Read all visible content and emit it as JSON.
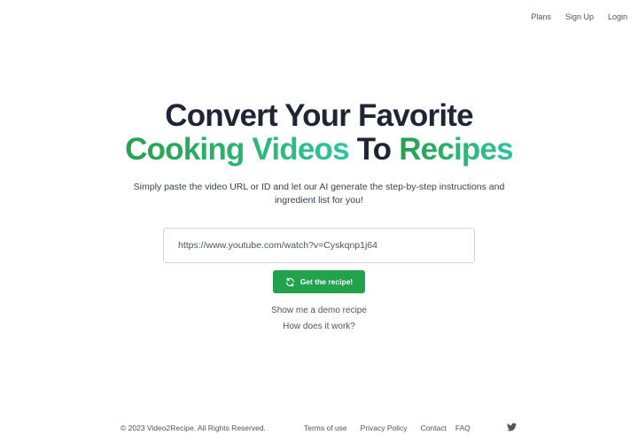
{
  "nav": {
    "plans": "Plans",
    "signup": "Sign Up",
    "login": "Login"
  },
  "hero": {
    "headline_line1": "Convert Your Favorite",
    "headline_green_1": "Cooking Videos",
    "headline_dark": "To",
    "headline_green_2": "Recipes",
    "subtitle": "Simply paste the video URL or ID and let our AI generate the step-by-step instructions and ingredient list for you!",
    "url_value": "https://www.youtube.com/watch?v=Cyskqnp1j64",
    "button_label": "Get the recipe!",
    "demo_link": "Show me a demo recipe",
    "how_link": "How does it work?"
  },
  "footer": {
    "copyright": "© 2023 Video2Recipe. All Rights Reserved.",
    "terms": "Terms of use",
    "privacy": "Privacy Policy",
    "contact": "Contact",
    "faq": "FAQ"
  },
  "colors": {
    "accent_green": "#23a24d",
    "heading_dark": "#1e2535",
    "gradient_start": "#27a04f",
    "gradient_end": "#2ec4a0"
  },
  "icons": {
    "button_icon": "refresh-icon",
    "social_icon": "twitter-icon"
  }
}
